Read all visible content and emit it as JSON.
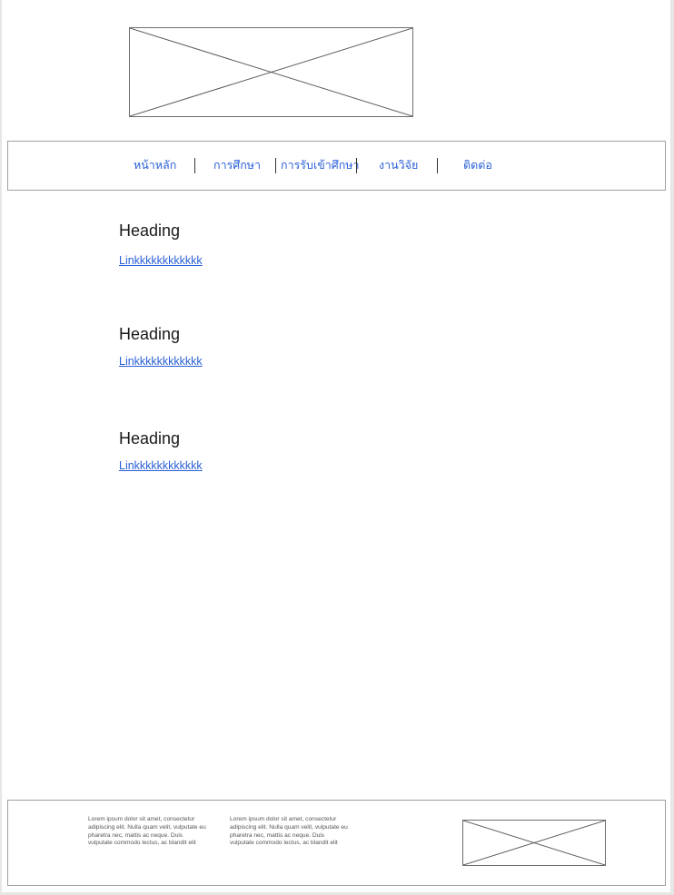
{
  "header": {
    "logo_icon": "image-placeholder-icon"
  },
  "nav": {
    "items": [
      {
        "label": "หน้าหลัก"
      },
      {
        "label": "การศึกษา"
      },
      {
        "label": "การรับเข้าศึกษา"
      },
      {
        "label": "งานวิจัย"
      },
      {
        "label": "ติดต่อ"
      }
    ]
  },
  "sections": [
    {
      "heading": "Heading",
      "link": "Linkkkkkkkkkkkk"
    },
    {
      "heading": "Heading",
      "link": "Linkkkkkkkkkkkk"
    },
    {
      "heading": "Heading",
      "link": "Linkkkkkkkkkkkk"
    }
  ],
  "footer": {
    "text_1": "Lorem ipsum dolor sit amet, consectetur adipiscing elit. Nulla quam velit, vulputate eu pharetra nec, mattis ac neque. Duis vulputate commodo lectus, ac blandit elit",
    "text_2": "Lorem ipsum dolor sit amet, consectetur adipiscing elit. Nulla quam velit, vulputate eu pharetra nec, mattis ac neque. Duis vulputate commodo lectus, ac blandit elit",
    "image_icon": "image-placeholder-icon"
  },
  "colors": {
    "link": "#2a5fd6",
    "border": "#a0a0a0",
    "page_background": "#ffffff",
    "outer_background": "#e6e6e6"
  }
}
